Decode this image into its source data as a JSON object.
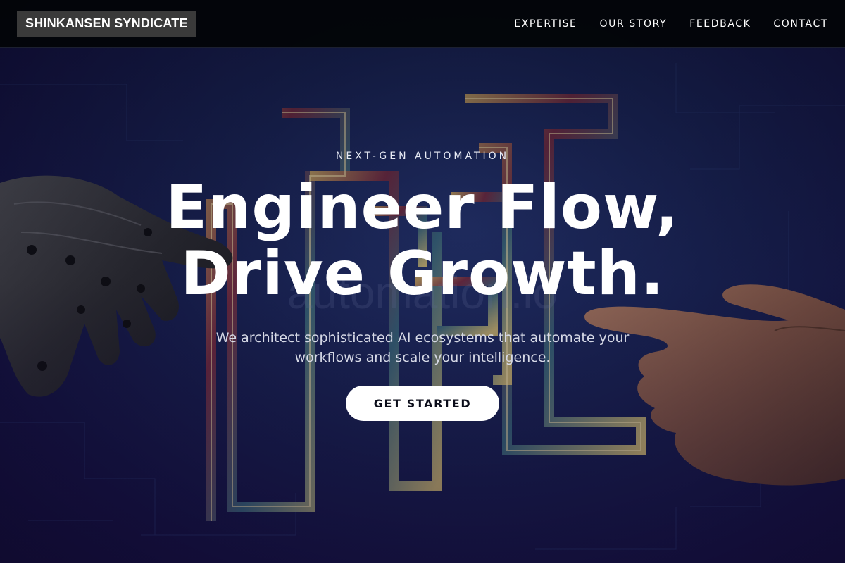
{
  "brand": {
    "name": "SHINKANSEN SYNDICATE"
  },
  "nav": {
    "items": [
      {
        "label": "EXPERTISE"
      },
      {
        "label": "OUR STORY"
      },
      {
        "label": "FEEDBACK"
      },
      {
        "label": "CONTACT"
      }
    ]
  },
  "hero": {
    "eyebrow": "NEXT-GEN AUTOMATION",
    "headline_line1": "Engineer Flow,",
    "headline_line2": "Drive Growth.",
    "subtext": "We architect sophisticated AI ecosystems that automate your workflows and scale your intelligence.",
    "cta_label": "GET STARTED"
  },
  "colors": {
    "navbar_bg": "#030508",
    "logo_bg": "#3a3a3a",
    "hero_bg": "#18214f",
    "cta_bg": "#ffffff",
    "cta_text": "#0b0d1a"
  }
}
